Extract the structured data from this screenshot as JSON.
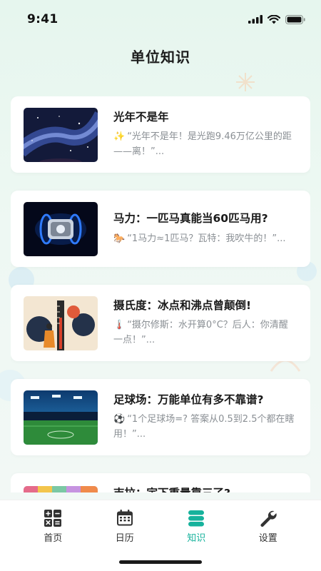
{
  "status_bar": {
    "time": "9:41"
  },
  "page": {
    "title": "单位知识"
  },
  "articles": [
    {
      "title": "光年不是年",
      "emoji": "✨",
      "desc": "“光年不是年！是光跑9.46万亿公里的距——离！”...",
      "image": "galaxy-night-sky"
    },
    {
      "title": "马力：一匹马真能当60匹马用?",
      "emoji": "🐎",
      "desc": "“1马力≈1匹马？瓦特：我吹牛的！”...",
      "image": "engine-rings"
    },
    {
      "title": "摄氏度：冰点和沸点曾颠倒!",
      "emoji": "🌡️",
      "desc": "“摄尔修斯：水开算0°C？后人：你清醒一点！”...",
      "image": "thermometer-illustration"
    },
    {
      "title": "足球场：万能单位有多不靠谱?",
      "emoji": "⚽",
      "desc": "“1个足球场=? 答案从0.5到2.5个都在瞎用！”...",
      "image": "stadium-lights"
    },
    {
      "title": "吉拉：宇下重量靠三了?",
      "emoji": "",
      "desc": "",
      "image": "colorful-mosaic"
    }
  ],
  "tabs": [
    {
      "label": "首页",
      "icon": "calculator-icon",
      "active": false
    },
    {
      "label": "日历",
      "icon": "calendar-icon",
      "active": false
    },
    {
      "label": "知识",
      "icon": "knowledge-icon",
      "active": true
    },
    {
      "label": "设置",
      "icon": "wrench-icon",
      "active": false
    }
  ],
  "colors": {
    "accent": "#16b29c",
    "background": "#e9f6ef",
    "card": "#ffffff"
  }
}
